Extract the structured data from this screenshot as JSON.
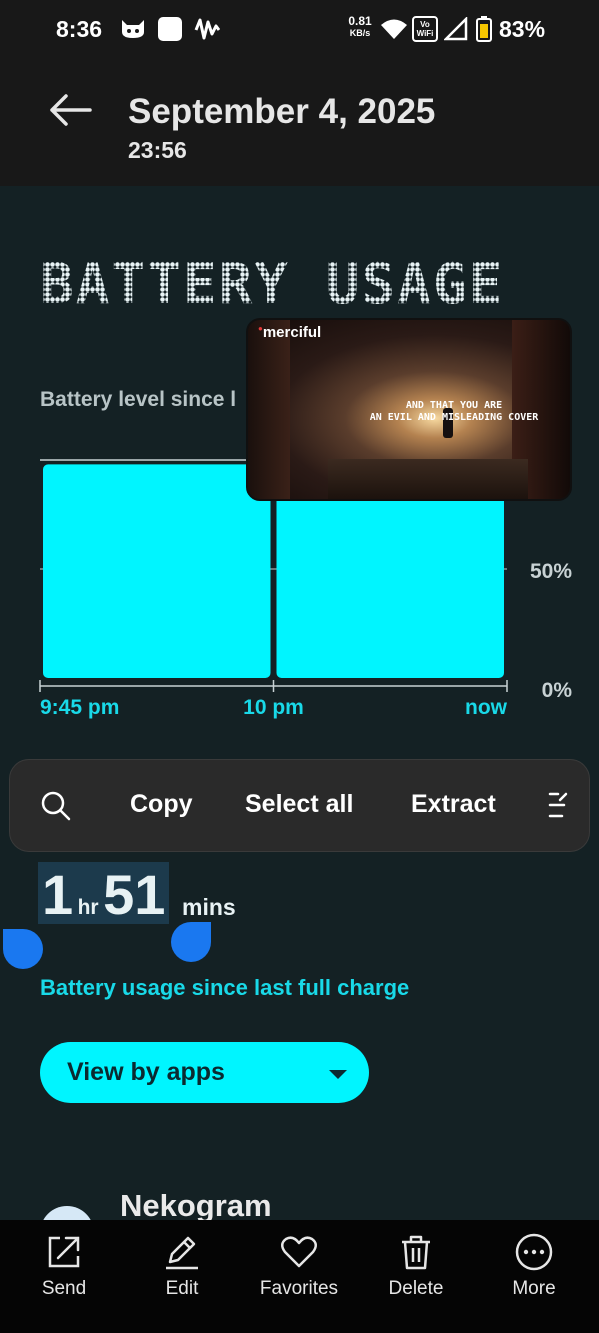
{
  "status_bar": {
    "time": "8:36",
    "net_speed_value": "0.81",
    "net_speed_unit": "KB/s",
    "wifi_calling_label": "Vo WiFi",
    "battery_percent": "83%"
  },
  "header": {
    "date": "September 4, 2025",
    "time": "23:56"
  },
  "page": {
    "title": "BATTERY USAGE",
    "battery_level_label": "Battery level since l"
  },
  "chart_data": {
    "type": "bar",
    "categories": [
      "9:45 pm",
      "10 pm"
    ],
    "values": [
      98,
      94
    ],
    "x_tick_labels": [
      "9:45 pm",
      "10 pm",
      "now"
    ],
    "y_tick_labels": [
      "50%",
      "0%"
    ],
    "ylim": [
      0,
      100
    ],
    "bar_color": "#00f5ff",
    "grid": true
  },
  "pip_video": {
    "logo_text": "merciful",
    "subtitle_line1": "AND THAT YOU ARE",
    "subtitle_line2": "AN EVIL AND MISLEADING COVER"
  },
  "selection_toolbar": {
    "copy_label": "Copy",
    "select_all_label": "Select all",
    "extract_label": "Extract"
  },
  "usage": {
    "hours": "1",
    "hours_unit": "hr",
    "minutes": "51",
    "minutes_unit": "mins",
    "caption": "Battery usage since last full charge"
  },
  "view_selector": {
    "selected": "View by apps"
  },
  "app_list": [
    {
      "name": "Nekogram"
    }
  ],
  "bottom_bar": {
    "send": "Send",
    "edit": "Edit",
    "favorites": "Favorites",
    "delete": "Delete",
    "more": "More"
  },
  "colors": {
    "accent": "#00f5ff",
    "caption": "#19d9e8",
    "selection_handle": "#1a78f0",
    "background": "#142124"
  }
}
